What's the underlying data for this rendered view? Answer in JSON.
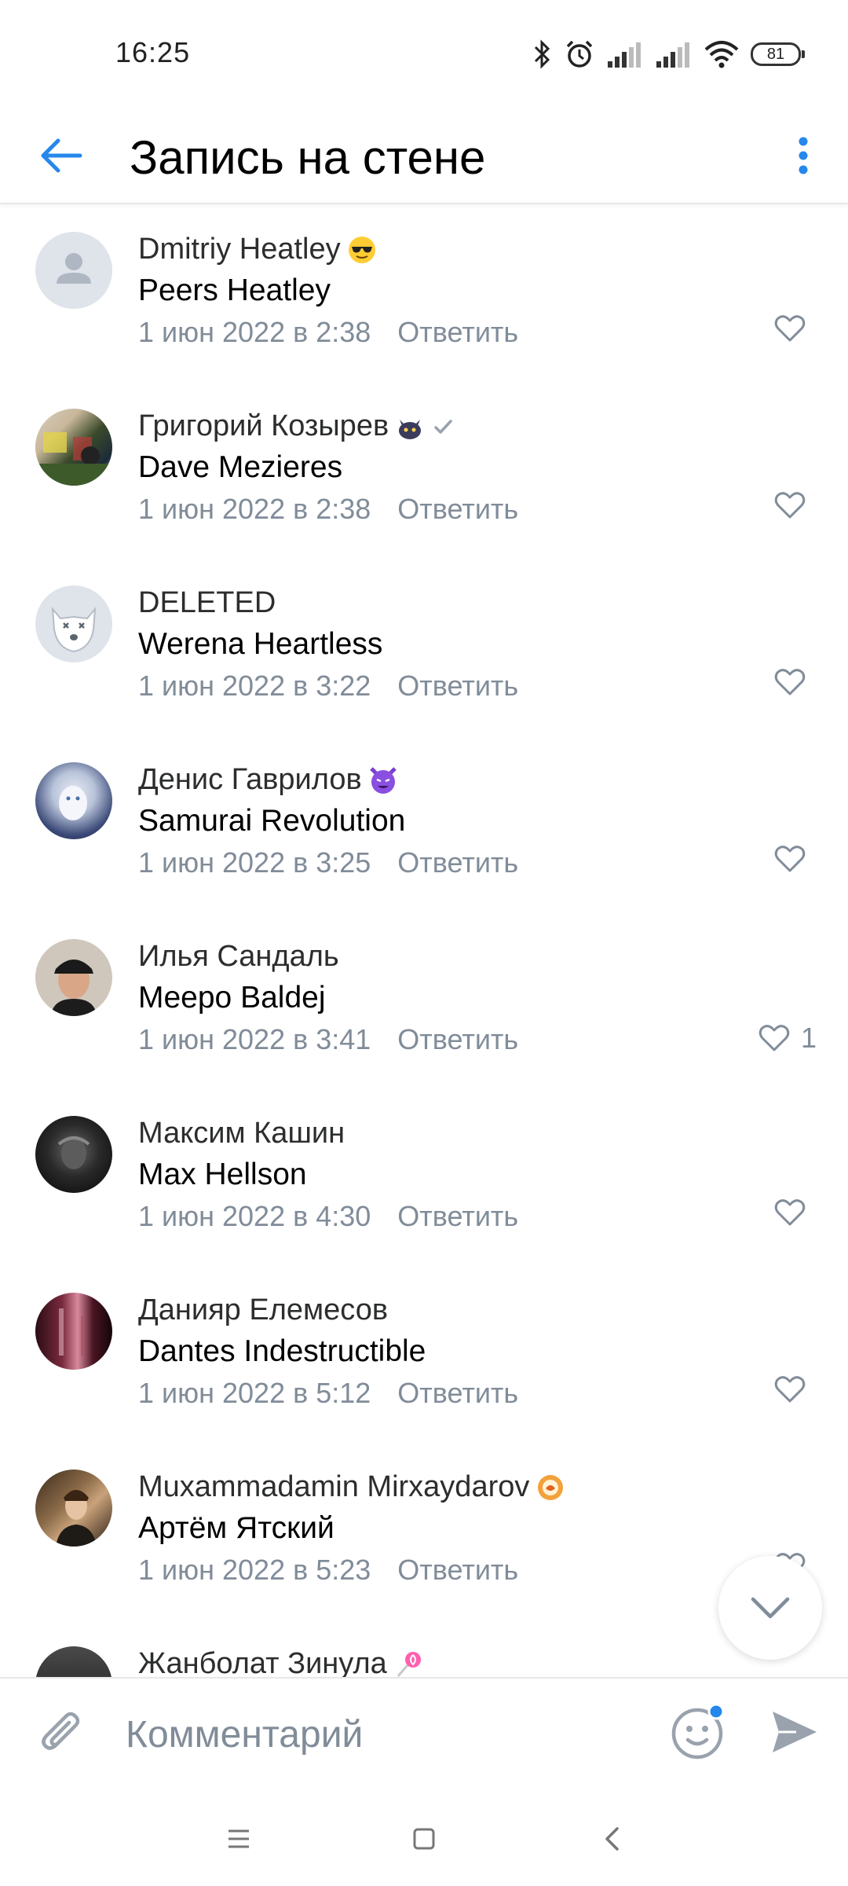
{
  "status_bar": {
    "time": "16:25",
    "battery": "81"
  },
  "header": {
    "title": "Запись на стене"
  },
  "reply_label": "Ответить",
  "comments": [
    {
      "author": "Dmitriy Heatley",
      "badge": "sunglasses-emoji",
      "text": "Peers Heatley",
      "date": "1 июн 2022 в 2:38",
      "likes": ""
    },
    {
      "author": "Григорий Козырев",
      "badge": "cat-emoji",
      "verified": true,
      "text": "Dave Mezieres",
      "date": "1 июн 2022 в 2:38",
      "likes": ""
    },
    {
      "author": "DELETED",
      "badge": "",
      "text": "Werena Heartless",
      "date": "1 июн 2022 в 3:22",
      "likes": ""
    },
    {
      "author": "Денис Гаврилов",
      "badge": "purple-devil-emoji",
      "text": "Samurai Revolution",
      "date": "1 июн 2022 в 3:25",
      "likes": ""
    },
    {
      "author": "Илья Сандаль",
      "badge": "",
      "text": "Meepo Baldej",
      "date": "1 июн 2022 в 3:41",
      "likes": "1"
    },
    {
      "author": "Максим Кашин",
      "badge": "",
      "text": "Max Hellson",
      "date": "1 июн 2022 в 4:30",
      "likes": ""
    },
    {
      "author": "Данияр Елемесов",
      "badge": "",
      "text": "Dantes Indestructible",
      "date": "1 июн 2022 в 5:12",
      "likes": ""
    },
    {
      "author": "Muxammadamin Mirxaydarov",
      "badge": "orange-sticker-emoji",
      "text": "Артём Ятский",
      "date": "1 июн 2022 в 5:23",
      "likes": ""
    },
    {
      "author": "Жанболат Зинула",
      "badge": "lollipop-emoji",
      "text": "",
      "date": "",
      "likes": ""
    }
  ],
  "composer": {
    "placeholder": "Комментарий"
  },
  "colors": {
    "accent": "#2688eb",
    "secondary_text": "#818c99",
    "divider": "#e7e8ec"
  },
  "icons": [
    "back-arrow-icon",
    "more-vertical-icon",
    "heart-icon",
    "chevron-down-icon",
    "paperclip-icon",
    "smile-icon",
    "send-icon",
    "menu-icon",
    "home-square-icon",
    "back-chevron-icon"
  ]
}
